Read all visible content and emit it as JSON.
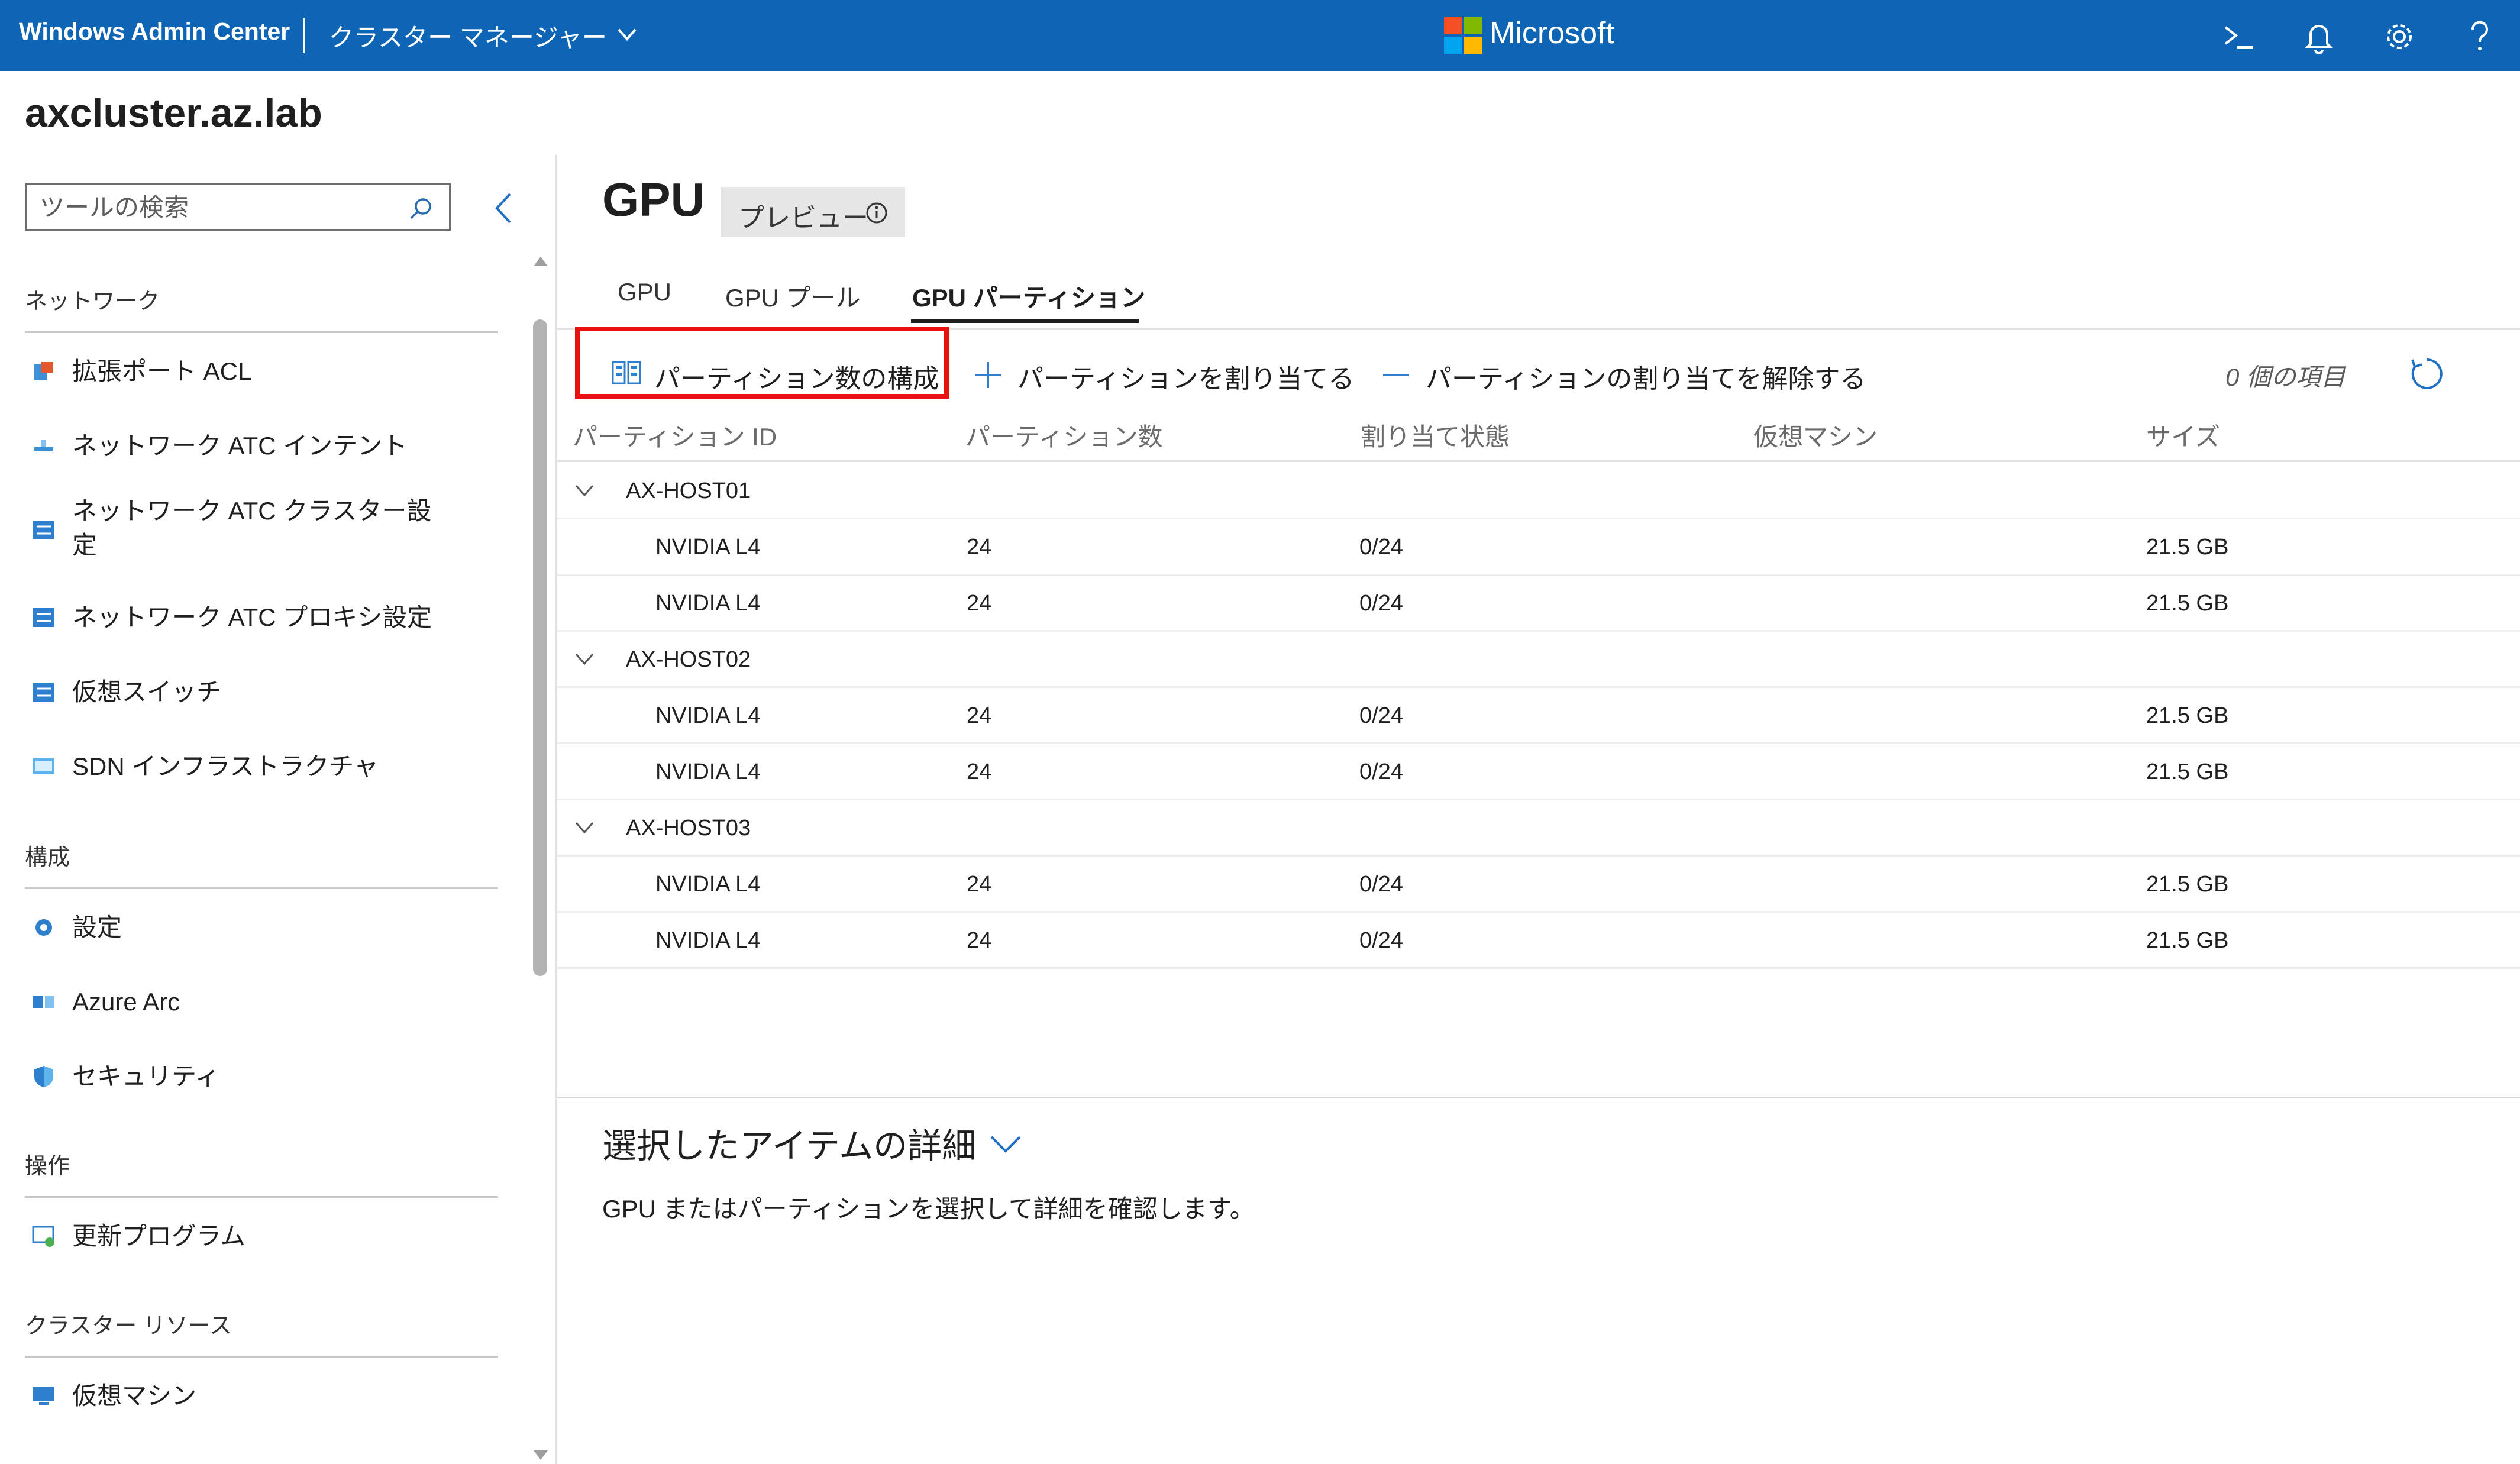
{
  "header": {
    "brand": "Windows Admin Center",
    "context": "クラスター マネージャー",
    "microsoft": "Microsoft",
    "icons": [
      "terminal-icon",
      "bell-icon",
      "gear-icon",
      "help-icon"
    ]
  },
  "page_title": "axcluster.az.lab",
  "sidebar": {
    "search_placeholder": "ツールの検索",
    "sections": [
      {
        "title": "ネットワーク",
        "items": [
          {
            "label": "拡張ポート ACL",
            "icon": "acl-icon"
          },
          {
            "label": "ネットワーク ATC インテント",
            "icon": "network-intent-icon"
          },
          {
            "label": "ネットワーク ATC クラスター設",
            "label2": "定",
            "icon": "network-settings-icon"
          },
          {
            "label": "ネットワーク ATC プロキシ設定",
            "icon": "proxy-settings-icon"
          },
          {
            "label": "仮想スイッチ",
            "icon": "virtual-switch-icon"
          },
          {
            "label": "SDN インフラストラクチャ",
            "icon": "sdn-icon"
          }
        ]
      },
      {
        "title": "構成",
        "items": [
          {
            "label": "設定",
            "icon": "settings-icon"
          },
          {
            "label": "Azure Arc",
            "icon": "azure-arc-icon"
          },
          {
            "label": "セキュリティ",
            "icon": "shield-icon"
          }
        ]
      },
      {
        "title": "操作",
        "items": [
          {
            "label": "更新プログラム",
            "icon": "updates-icon"
          }
        ]
      },
      {
        "title": "クラスター リソース",
        "items": [
          {
            "label": "仮想マシン",
            "icon": "virtual-machine-icon"
          }
        ]
      }
    ]
  },
  "main": {
    "title": "GPU",
    "badge": "プレビュー",
    "tabs": [
      {
        "label": "GPU",
        "active": false
      },
      {
        "label": "GPU プール",
        "active": false
      },
      {
        "label": "GPU パーティション",
        "active": true
      }
    ],
    "toolbar": {
      "configure": "パーティション数の構成",
      "assign": "パーティションを割り当てる",
      "unassign": "パーティションの割り当てを解除する",
      "count": "0 個の項目"
    },
    "columns": [
      "パーティション ID",
      "パーティション数",
      "割り当て状態",
      "仮想マシン",
      "サイズ"
    ],
    "groups": [
      {
        "host": "AX-HOST01",
        "rows": [
          {
            "id": "NVIDIA L4",
            "count": "24",
            "state": "0/24",
            "vm": "",
            "size": "21.5 GB"
          },
          {
            "id": "NVIDIA L4",
            "count": "24",
            "state": "0/24",
            "vm": "",
            "size": "21.5 GB"
          }
        ]
      },
      {
        "host": "AX-HOST02",
        "rows": [
          {
            "id": "NVIDIA L4",
            "count": "24",
            "state": "0/24",
            "vm": "",
            "size": "21.5 GB"
          },
          {
            "id": "NVIDIA L4",
            "count": "24",
            "state": "0/24",
            "vm": "",
            "size": "21.5 GB"
          }
        ]
      },
      {
        "host": "AX-HOST03",
        "rows": [
          {
            "id": "NVIDIA L4",
            "count": "24",
            "state": "0/24",
            "vm": "",
            "size": "21.5 GB"
          },
          {
            "id": "NVIDIA L4",
            "count": "24",
            "state": "0/24",
            "vm": "",
            "size": "21.5 GB"
          }
        ]
      }
    ],
    "details": {
      "title": "選択したアイテムの詳細",
      "text": "GPU またはパーティションを選択して詳細を確認します。"
    }
  },
  "colors": {
    "topbar": "#0f65b5",
    "accent": "#0f65b5",
    "highlight": "#ea1010"
  }
}
